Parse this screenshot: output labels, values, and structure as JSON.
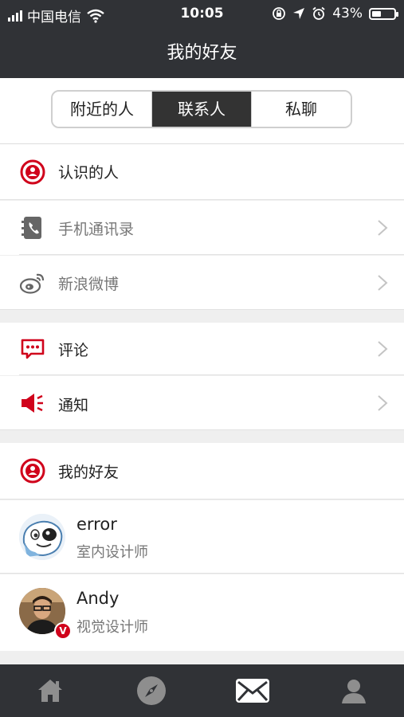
{
  "status_bar": {
    "carrier": "中国电信",
    "time": "10:05",
    "battery": "43%",
    "battery_level": 0.43
  },
  "nav": {
    "title": "我的好友"
  },
  "segments": [
    {
      "label": "附近的人",
      "active": false
    },
    {
      "label": "联系人",
      "active": true
    },
    {
      "label": "私聊",
      "active": false
    }
  ],
  "section1": {
    "header": "认识的人",
    "items": [
      {
        "label": "手机通讯录",
        "icon": "contacts-book-icon"
      },
      {
        "label": "新浪微博",
        "icon": "weibo-icon"
      }
    ]
  },
  "section2": {
    "items": [
      {
        "label": "评论",
        "icon": "comment-icon"
      },
      {
        "label": "通知",
        "icon": "megaphone-icon"
      }
    ]
  },
  "section3": {
    "header": "我的好友",
    "friends": [
      {
        "name": "error",
        "title": "室内设计师",
        "verified": false
      },
      {
        "name": "Andy",
        "title": "视觉设计师",
        "verified": true
      }
    ]
  },
  "tab_bar": {
    "tabs": [
      {
        "icon": "home-icon",
        "active": false
      },
      {
        "icon": "compass-icon",
        "active": false
      },
      {
        "icon": "mail-icon",
        "active": true
      },
      {
        "icon": "profile-icon",
        "active": false
      }
    ]
  },
  "colors": {
    "accent_red": "#d0021b",
    "bar_dark": "#303236"
  }
}
